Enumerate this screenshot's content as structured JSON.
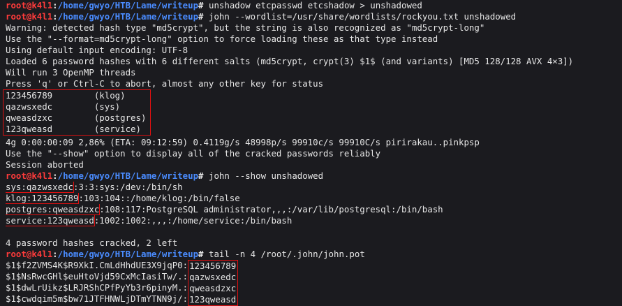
{
  "prompt": {
    "user": "root",
    "at": "@",
    "host": "k4l1",
    "path": "/home/gwyo/HTB/Lame/writeup",
    "symbol": "#"
  },
  "cmd1": "unshadow etcpasswd etcshadow > unshadowed",
  "cmd2": "john --wordlist=/usr/share/wordlists/rockyou.txt unshadowed",
  "out2": [
    "Warning: detected hash type \"md5crypt\", but the string is also recognized as \"md5crypt-long\"",
    "Use the \"--format=md5crypt-long\" option to force loading these as that type instead",
    "Using default input encoding: UTF-8",
    "Loaded 6 password hashes with 6 different salts (md5crypt, crypt(3) $1$ (and variants) [MD5 128/128 AVX 4×3])",
    "Will run 3 OpenMP threads",
    "Press 'q' or Ctrl-C to abort, almost any other key for status"
  ],
  "cracked": [
    {
      "password": "123456789",
      "user": "(klog)"
    },
    {
      "password": "qazwsxedc",
      "user": "(sys)"
    },
    {
      "password": "qweasdzxc",
      "user": "(postgres)"
    },
    {
      "password": "123qweasd",
      "user": "(service)"
    }
  ],
  "out2b": [
    "4g 0:00:00:09 2,86% (ETA: 09:12:59) 0.4119g/s 48998p/s 99910c/s 99910C/s pirirakau..pinkpsp",
    "Use the \"--show\" option to display all of the cracked passwords reliably",
    "Session aborted"
  ],
  "cmd3": "john --show unshadowed",
  "show": [
    {
      "cred": "sys:qazwsxedc",
      "rest": ":3:3:sys:/dev:/bin/sh"
    },
    {
      "cred": "klog:123456789",
      "rest": ":103:104::/home/klog:/bin/false"
    },
    {
      "cred": "postgres:qweasdzxc",
      "rest": ":108:117:PostgreSQL administrator,,,:/var/lib/postgresql:/bin/bash"
    },
    {
      "cred": "service:123qweasd",
      "rest": ":1002:1002:,,,:/home/service:/bin/bash"
    }
  ],
  "blank": "",
  "summary": "4 password hashes cracked, 2 left",
  "cmd4": "tail -n 4 /root/.john/john.pot",
  "pot": [
    {
      "hash": "$1$f2ZVMS4K$R9XkI.CmLdHhdUE3X9jqP0:",
      "pw": "123456789"
    },
    {
      "hash": "$1$NsRwcGHl$euHtoVjd59CxMcIasiTw/.:",
      "pw": "qazwsxedc"
    },
    {
      "hash": "$1$dwLrUikz$LRJRShCPfPyYb3r6pinyM.:",
      "pw": "qweasdzxc"
    },
    {
      "hash": "$1$cwdqim5m$bw71JTFHNWLjDTmYTNN9j/:",
      "pw": "123qweasd"
    }
  ]
}
